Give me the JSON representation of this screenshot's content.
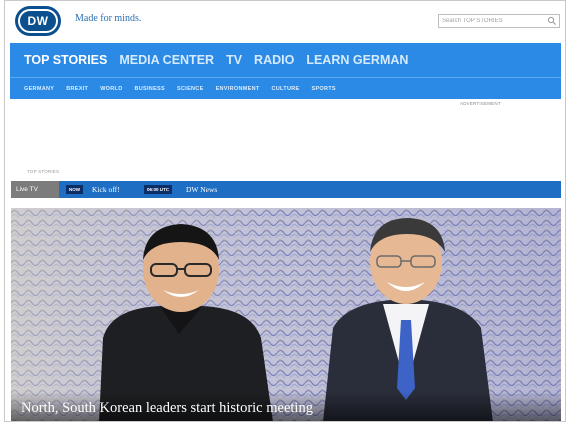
{
  "header": {
    "logo_text": "DW",
    "tagline": "Made for minds.",
    "search_placeholder": "Search TOP STORIES"
  },
  "nav": {
    "main": [
      {
        "label": "TOP STORIES",
        "active": true
      },
      {
        "label": "MEDIA CENTER",
        "active": false
      },
      {
        "label": "TV",
        "active": false
      },
      {
        "label": "RADIO",
        "active": false
      },
      {
        "label": "LEARN GERMAN",
        "active": false
      }
    ],
    "sub": [
      "GERMANY",
      "BREXIT",
      "WORLD",
      "BUSINESS",
      "SCIENCE",
      "ENVIRONMENT",
      "CULTURE",
      "SPORTS"
    ]
  },
  "ad_label": "ADVERTISEMENT",
  "section_label": "TOP STORIES",
  "livebar": {
    "live_label": "Live TV",
    "now_tag": "NOW",
    "now_title": "Kick off!",
    "time_tag": "06:00 UTC",
    "time_title": "DW News"
  },
  "hero": {
    "caption": "North, South Korean leaders start historic meeting"
  },
  "colors": {
    "brand_blue": "#2a8ae6",
    "logo_blue": "#0b4f8f",
    "livebar_blue": "#1e6fc4",
    "tag_navy": "#0b2e66"
  },
  "icons": {
    "search": "magnifier-icon",
    "logo": "dw-logo-icon"
  }
}
